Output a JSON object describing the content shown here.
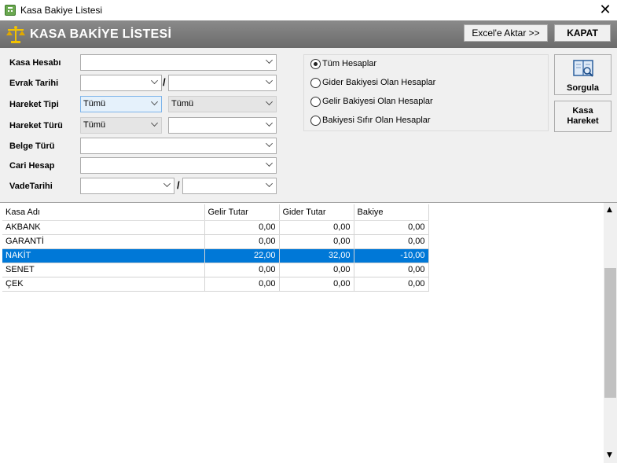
{
  "window": {
    "title": "Kasa Bakiye Listesi",
    "close_glyph": "✕",
    "icon": "calculator-icon"
  },
  "header": {
    "title": "KASA BAKİYE LİSTESİ",
    "excel_label": "Excel'e Aktar >>",
    "close_label": "KAPAT",
    "icon": "scale-icon"
  },
  "filters": {
    "kasa_hesabi": {
      "label": "Kasa Hesabı",
      "value": ""
    },
    "evrak_tarihi": {
      "label": "Evrak Tarihi",
      "from": "",
      "to": "",
      "separator": "/"
    },
    "hareket_tipi": {
      "label": "Hareket Tipi",
      "value1": "Tümü",
      "value2": "Tümü"
    },
    "hareket_turu": {
      "label": "Hareket Türü",
      "value1": "Tümü",
      "value2": ""
    },
    "belge_turu": {
      "label": "Belge Türü",
      "value": ""
    },
    "cari_hesap": {
      "label": "Cari Hesap",
      "value": ""
    },
    "vade_tarihi": {
      "label": "VadeTarihi",
      "from": "",
      "to": "",
      "separator": "/"
    }
  },
  "radio_options": [
    {
      "label": "Tüm Hesaplar",
      "checked": true
    },
    {
      "label": "Gider Bakiyesi Olan Hesaplar",
      "checked": false
    },
    {
      "label": "Gelir Bakiyesi Olan Hesaplar",
      "checked": false
    },
    {
      "label": "Bakiyesi Sıfır Olan Hesaplar",
      "checked": false
    }
  ],
  "side_buttons": {
    "sorgula": "Sorgula",
    "kasa_line1": "Kasa",
    "kasa_line2": "Hareket"
  },
  "grid": {
    "columns": [
      "Kasa Adı",
      "Gelir Tutar",
      "Gider Tutar",
      "Bakiye"
    ],
    "rows": [
      {
        "name": "AKBANK",
        "gelir": "0,00",
        "gider": "0,00",
        "bakiye": "0,00",
        "selected": false
      },
      {
        "name": "GARANTİ",
        "gelir": "0,00",
        "gider": "0,00",
        "bakiye": "0,00",
        "selected": false
      },
      {
        "name": "NAKİT",
        "gelir": "22,00",
        "gider": "32,00",
        "bakiye": "-10,00",
        "selected": true
      },
      {
        "name": "SENET",
        "gelir": "0,00",
        "gider": "0,00",
        "bakiye": "0,00",
        "selected": false
      },
      {
        "name": "ÇEK",
        "gelir": "0,00",
        "gider": "0,00",
        "bakiye": "0,00",
        "selected": false
      }
    ]
  },
  "colors": {
    "selection": "#0078d7",
    "header_bg": "#7a7a7a",
    "panel_bg": "#f0f0f0"
  }
}
